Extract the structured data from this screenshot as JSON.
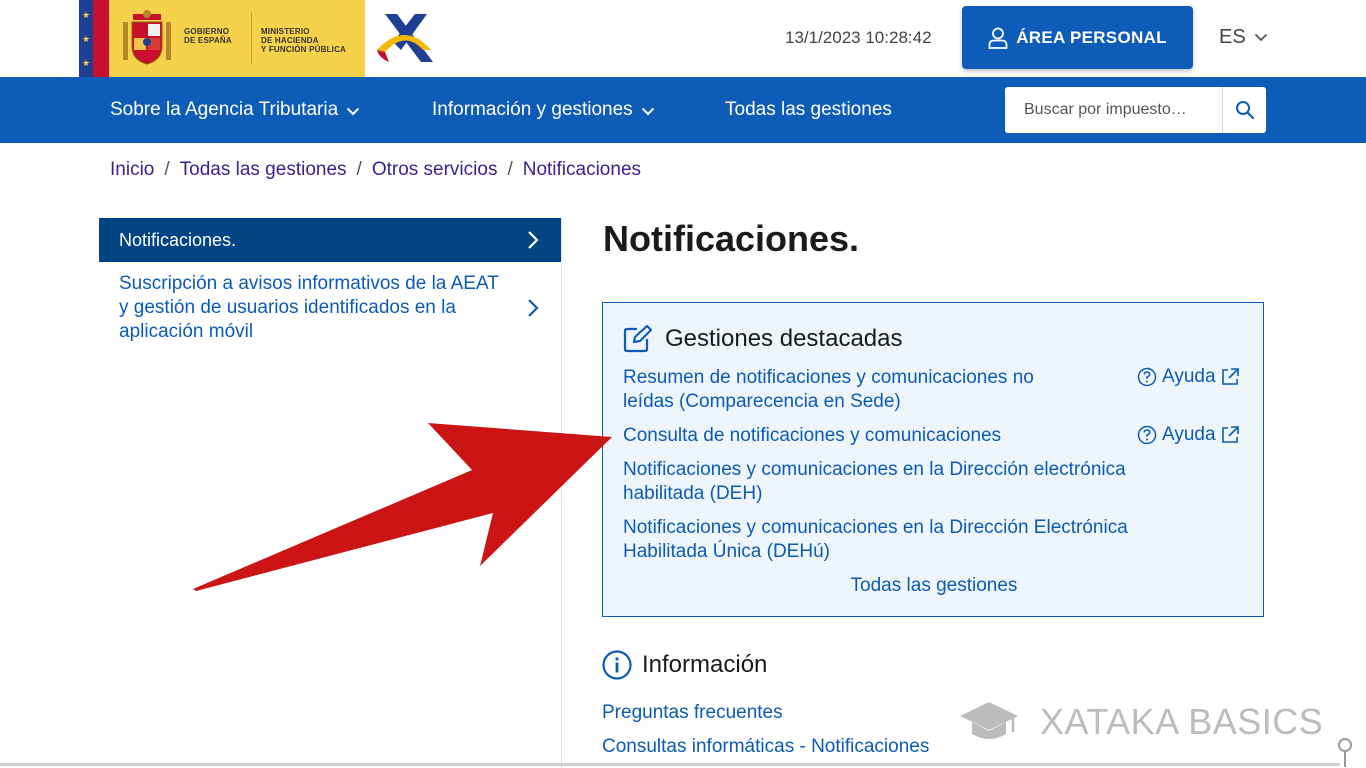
{
  "header": {
    "gov_text": [
      "GOBIERNO",
      "DE ESPAÑA"
    ],
    "ministry_text": [
      "MINISTERIO",
      "DE HACIENDA",
      "Y FUNCIÓN PÚBLICA"
    ],
    "datetime": "13/1/2023 10:28:42",
    "area_personal_label": "ÁREA PERSONAL",
    "language": "ES"
  },
  "nav": {
    "items": [
      {
        "label": "Sobre la Agencia Tributaria",
        "has_dropdown": true
      },
      {
        "label": "Información y gestiones",
        "has_dropdown": true
      },
      {
        "label": "Todas las gestiones",
        "has_dropdown": false
      }
    ],
    "search": {
      "placeholder": "Buscar por impuesto…",
      "value": ""
    }
  },
  "breadcrumb": [
    "Inicio",
    "Todas las gestiones",
    "Otros servicios",
    "Notificaciones"
  ],
  "sidebar": {
    "items": [
      {
        "label": "Notificaciones.",
        "active": true
      },
      {
        "label": "Suscripción a avisos informativos de la AEAT y gestión de usuarios identificados en la aplicación móvil",
        "active": false
      }
    ]
  },
  "main": {
    "title": "Notificaciones.",
    "gestiones": {
      "heading": "Gestiones destacadas",
      "links": [
        {
          "label": "Resumen de notificaciones y comunicaciones no leídas (Comparecencia en Sede)",
          "help": "Ayuda"
        },
        {
          "label": "Consulta de notificaciones y comunicaciones",
          "help": "Ayuda"
        },
        {
          "label": "Notificaciones y comunicaciones en la Dirección electrónica habilitada (DEH)",
          "help": ""
        },
        {
          "label": "Notificaciones y comunicaciones en la Dirección Electrónica Habilitada Única (DEHú)",
          "help": ""
        }
      ],
      "all_label": "Todas las gestiones"
    },
    "informacion": {
      "heading": "Información",
      "links": [
        "Preguntas frecuentes",
        "Consultas informáticas - Notificaciones"
      ]
    }
  },
  "watermark": "XATAKA BASICS",
  "colors": {
    "nav_blue": "#0d5db8",
    "sidebar_active": "#004484",
    "link_blue": "#0b5bb5",
    "breadcrumb_purple": "#3b1f8e",
    "box_bg": "#eef6fc",
    "arrow_red": "#cc1414",
    "gov_yellow": "#f6d14a"
  },
  "icons": [
    "user-icon",
    "chevron-down-icon",
    "search-icon",
    "chevron-right-icon",
    "edit-icon",
    "help-circle-icon",
    "external-link-icon",
    "info-circle-icon",
    "graduation-cap-icon",
    "red-arrow"
  ]
}
